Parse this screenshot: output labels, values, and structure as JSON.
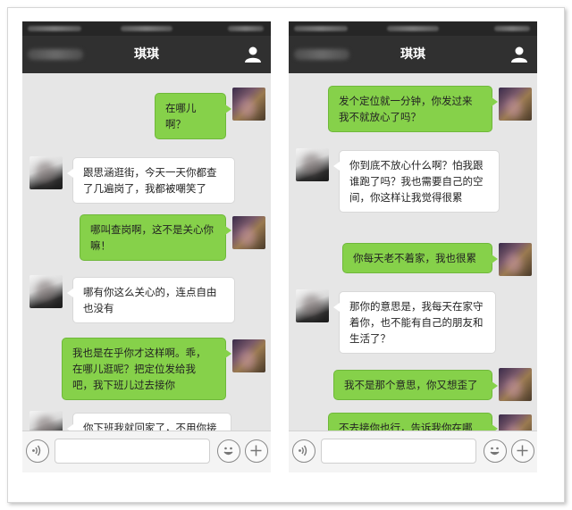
{
  "left_screen": {
    "title": "琪琪",
    "messages": [
      {
        "from": "me",
        "text": "在哪儿啊？"
      },
      {
        "from": "her",
        "text": "跟思涵逛街，今天一天你都查了几遍岗了，我都被嘲笑了"
      },
      {
        "from": "me",
        "text": "哪叫查岗啊，这不是关心你嘛！"
      },
      {
        "from": "her",
        "text": "哪有你这么关心的，连点自由也没有"
      },
      {
        "from": "me",
        "text": "我也是在乎你才这样啊。乖，在哪儿逛呢？把定位发给我吧，我下班儿过去接你"
      },
      {
        "from": "her",
        "text": "你下班我就回家了，不用你接"
      }
    ]
  },
  "right_screen": {
    "title": "琪琪",
    "messages": [
      {
        "from": "me",
        "text": "发个定位就一分钟，你发过来我不就放心了吗？"
      },
      {
        "from": "her",
        "text": "你到底不放心什么啊？怕我跟谁跑了吗？我也需要自己的空间，你这样让我觉得很累"
      },
      {
        "from": "me",
        "text": "你每天老不着家，我也很累"
      },
      {
        "from": "her",
        "text": "那你的意思是，我每天在家守着你，也不能有自己的朋友和生活了？"
      },
      {
        "from": "me",
        "text": "我不是那个意思，你又想歪了"
      },
      {
        "from": "me",
        "text": "不去接你也行，告诉我你在哪儿啊"
      }
    ]
  },
  "icons": {
    "profile": "person-icon",
    "voice": "voice-icon",
    "emoji": "emoji-icon",
    "plus": "plus-icon"
  },
  "colors": {
    "outgoing_bubble": "#86d14a",
    "incoming_bubble": "#ffffff",
    "titlebar": "#303030",
    "chat_background": "#e6e6e6"
  }
}
